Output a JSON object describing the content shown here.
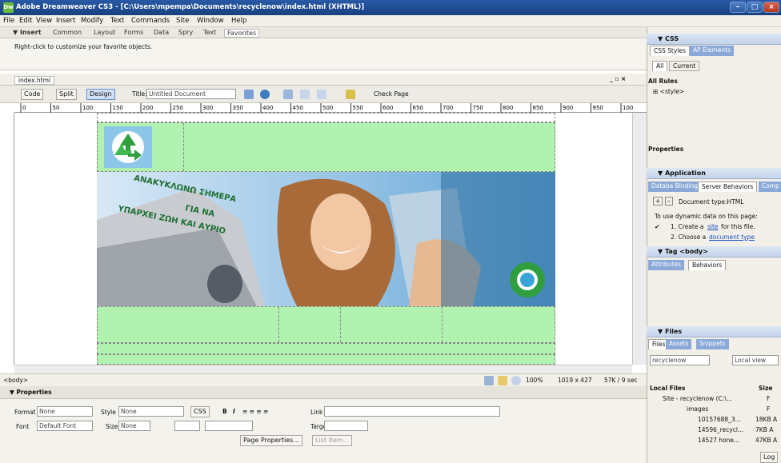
{
  "window": {
    "title": "Adobe Dreamweaver CS3 - [C:\\Users\\mpempa\\Documents\\recyclenow\\index.html (XHTML)]",
    "app_icon": "Dw"
  },
  "menu": [
    "File",
    "Edit",
    "View",
    "Insert",
    "Modify",
    "Text",
    "Commands",
    "Site",
    "Window",
    "Help"
  ],
  "insert_bar": {
    "label": "▼ Insert",
    "tabs": [
      "Common",
      "Layout",
      "Forms",
      "Data",
      "Spry",
      "Text",
      "Favorites"
    ],
    "message": "Right-click to customize your favorite objects."
  },
  "document": {
    "tab_name": "index.html",
    "view_buttons": [
      "Code",
      "Split",
      "Design"
    ],
    "title_label": "Title:",
    "title_value": "Untitled Document",
    "check_page": "Check Page",
    "ruler_ticks": [
      "0",
      "50",
      "100",
      "150",
      "200",
      "250",
      "300",
      "350",
      "400",
      "450",
      "500",
      "550",
      "600",
      "650",
      "700",
      "750",
      "800",
      "850",
      "900",
      "950",
      "100"
    ],
    "banner_text_line1": "ΑΝΑΚΥΚΛΩΝΩ ΣΗΜΕΡΑ",
    "banner_text_line2": "ΓΙΑ ΝΑ",
    "banner_text_line3": "ΥΠΑΡΧΕΙ ΖΩΗ ΚΑΙ ΑΥΡΙΟ"
  },
  "status": {
    "tag": "<body>",
    "zoom": "100%",
    "size": "1019 x 427",
    "weight": "57K / 9 sec"
  },
  "properties": {
    "header": "▼ Properties",
    "format_label": "Format",
    "format_value": "None",
    "style_label": "Style",
    "style_value": "None",
    "css_button": "CSS",
    "link_label": "Link",
    "font_label": "Font",
    "font_value": "Default Font",
    "size_label": "Size",
    "size_value": "None",
    "target_label": "Target",
    "page_properties": "Page Properties...",
    "list_item": "List Item..."
  },
  "right_panel": {
    "css_header": "▼ CSS",
    "css_tabs": [
      "CSS Styles",
      "AP Elements"
    ],
    "css_mode": [
      "All",
      "Current"
    ],
    "all_rules": "All Rules",
    "style_rule": "⊞ <style>",
    "properties_header": "Properties",
    "application_header": "▼ Application",
    "app_tabs": [
      "Databa Binding",
      "Server Behaviors",
      "Comp"
    ],
    "doc_type": "Document type:HTML",
    "dynamic_intro": "To use dynamic data on this page:",
    "step1_prefix": "1. Create a",
    "step1_link": "site",
    "step1_suffix": "for this file.",
    "step2_prefix": "2. Choose a",
    "step2_link": "document type",
    "tag_header": "▼ Tag <body>",
    "tag_tabs": [
      "Attributes",
      "Behaviors"
    ],
    "files_header": "▼ Files",
    "files_tabs": [
      "Files",
      "Assets",
      "Snippets"
    ],
    "site_select": "recyclenow",
    "view_select": "Local view",
    "local_files": "Local Files",
    "size_col": "Size",
    "tree": [
      {
        "name": "Site - recyclenow (C:\\...",
        "size": "F"
      },
      {
        "name": "images",
        "size": "F"
      },
      {
        "name": "10157688_3...",
        "size": "18KB A"
      },
      {
        "name": "14596_recycl...",
        "size": "7KB A"
      },
      {
        "name": "14527 hone...",
        "size": "47KB A"
      }
    ],
    "log_button": "Log"
  },
  "colors": {
    "titlebar": "#1f4c95",
    "table_green": "#b2f2b0",
    "panel_header": "#c3d3ea"
  }
}
